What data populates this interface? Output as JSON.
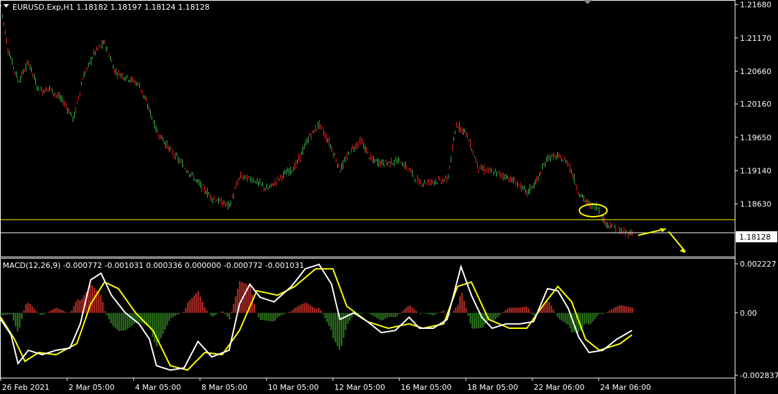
{
  "chart_data": [
    {
      "type": "candlestick",
      "title": "EURUSD.Exp,H1  1.18182 1.18197 1.18124 1.18128",
      "symbol": "EURUSD.Exp",
      "timeframe": "H1",
      "ohlc": {
        "open": 1.18182,
        "high": 1.18197,
        "low": 1.18124,
        "close": 1.18128
      },
      "current_price_label": "1.18128",
      "ylim": [
        1.1782,
        1.2174
      ],
      "yticks": [
        "1.21680",
        "1.21170",
        "1.20660",
        "1.20160",
        "1.19650",
        "1.19140",
        "1.18630"
      ],
      "x_ticks": [
        "26 Feb 2021",
        "2 Mar 05:00",
        "4 Mar 05:00",
        "8 Mar 05:00",
        "10 Mar 05:00",
        "12 Mar 05:00",
        "16 Mar 05:00",
        "18 Mar 05:00",
        "22 Mar 06:00",
        "24 Mar 06:00"
      ],
      "price_path": [
        [
          0,
          1.2166
        ],
        [
          10,
          1.21
        ],
        [
          25,
          1.205
        ],
        [
          40,
          1.208
        ],
        [
          55,
          1.2035
        ],
        [
          70,
          1.204
        ],
        [
          90,
          1.202
        ],
        [
          105,
          1.1993
        ],
        [
          118,
          1.2055
        ],
        [
          135,
          1.2095
        ],
        [
          150,
          1.211
        ],
        [
          165,
          1.2065
        ],
        [
          185,
          1.2055
        ],
        [
          200,
          1.2045
        ],
        [
          215,
          1.2005
        ],
        [
          225,
          1.1975
        ],
        [
          245,
          1.1945
        ],
        [
          265,
          1.192
        ],
        [
          285,
          1.1895
        ],
        [
          305,
          1.1872
        ],
        [
          330,
          1.186
        ],
        [
          345,
          1.1905
        ],
        [
          365,
          1.19
        ],
        [
          385,
          1.1885
        ],
        [
          405,
          1.1905
        ],
        [
          425,
          1.192
        ],
        [
          445,
          1.1965
        ],
        [
          460,
          1.1985
        ],
        [
          475,
          1.1955
        ],
        [
          490,
          1.1915
        ],
        [
          505,
          1.1945
        ],
        [
          520,
          1.196
        ],
        [
          535,
          1.193
        ],
        [
          555,
          1.1925
        ],
        [
          575,
          1.193
        ],
        [
          590,
          1.1915
        ],
        [
          605,
          1.1895
        ],
        [
          625,
          1.1898
        ],
        [
          645,
          1.19
        ],
        [
          658,
          1.1985
        ],
        [
          672,
          1.1972
        ],
        [
          690,
          1.1918
        ],
        [
          710,
          1.1912
        ],
        [
          730,
          1.1905
        ],
        [
          745,
          1.1895
        ],
        [
          760,
          1.188
        ],
        [
          775,
          1.19
        ],
        [
          790,
          1.1935
        ],
        [
          805,
          1.1935
        ],
        [
          820,
          1.1925
        ],
        [
          835,
          1.188
        ],
        [
          848,
          1.1863
        ],
        [
          862,
          1.1858
        ],
        [
          872,
          1.1835
        ],
        [
          885,
          1.1828
        ],
        [
          898,
          1.182
        ],
        [
          912,
          1.1818
        ]
      ],
      "levels": [
        1.1839,
        1.1819
      ],
      "annotations": [
        "ellipse-around-consolidation",
        "arrow-up",
        "arrow-down"
      ],
      "colors": {
        "bull": "#39b54a",
        "bear": "#e02020",
        "level": "#ffff00",
        "axis": "#ffffff"
      }
    },
    {
      "type": "macd",
      "title": "MACD(12,26,9) -0.000772 -0.001031 0.000336 0.000000 -0.000772 -0.001031",
      "ylim": [
        -0.002837,
        0.002227
      ],
      "yticks": [
        "0.002227",
        "0.00",
        "-0.002837"
      ],
      "series": [
        {
          "name": "MACD",
          "color": "#ffffff",
          "points": [
            [
              0,
              -0.0003
            ],
            [
              15,
              -0.001
            ],
            [
              25,
              -0.0023
            ],
            [
              40,
              -0.0017
            ],
            [
              60,
              -0.0019
            ],
            [
              80,
              -0.0017
            ],
            [
              100,
              -0.0016
            ],
            [
              115,
              -0.0005
            ],
            [
              130,
              0.0015
            ],
            [
              145,
              0.0018
            ],
            [
              160,
              0.0008
            ],
            [
              180,
              0.0
            ],
            [
              200,
              -0.0005
            ],
            [
              215,
              -0.0012
            ],
            [
              225,
              -0.0024
            ],
            [
              245,
              -0.0026
            ],
            [
              265,
              -0.0025
            ],
            [
              285,
              -0.0013
            ],
            [
              305,
              -0.002
            ],
            [
              330,
              -0.0017
            ],
            [
              345,
              0.0004
            ],
            [
              360,
              0.0013
            ],
            [
              375,
              0.0007
            ],
            [
              395,
              0.0005
            ],
            [
              420,
              0.0012
            ],
            [
              440,
              0.002
            ],
            [
              460,
              0.0022
            ],
            [
              478,
              0.0013
            ],
            [
              490,
              -0.0003
            ],
            [
              510,
              0.0
            ],
            [
              530,
              -0.0004
            ],
            [
              550,
              -0.0009
            ],
            [
              570,
              -0.0008
            ],
            [
              590,
              -0.0002
            ],
            [
              605,
              -0.0007
            ],
            [
              625,
              -0.0007
            ],
            [
              645,
              -0.0003
            ],
            [
              665,
              0.0021
            ],
            [
              680,
              0.0008
            ],
            [
              695,
              -0.0002
            ],
            [
              710,
              -0.0007
            ],
            [
              730,
              -0.0005
            ],
            [
              750,
              -0.0005
            ],
            [
              770,
              -0.0004
            ],
            [
              790,
              0.0011
            ],
            [
              805,
              0.001
            ],
            [
              820,
              0.0002
            ],
            [
              835,
              -0.0011
            ],
            [
              850,
              -0.0018
            ],
            [
              870,
              -0.0017
            ],
            [
              890,
              -0.0012
            ],
            [
              912,
              -0.0008
            ]
          ]
        },
        {
          "name": "Signal",
          "color": "#ffff00",
          "points": [
            [
              0,
              -0.0002
            ],
            [
              20,
              -0.0012
            ],
            [
              35,
              -0.0022
            ],
            [
              55,
              -0.0018
            ],
            [
              80,
              -0.0019
            ],
            [
              110,
              -0.0014
            ],
            [
              130,
              0.0004
            ],
            [
              150,
              0.0014
            ],
            [
              170,
              0.0011
            ],
            [
              195,
              0.0
            ],
            [
              220,
              -0.0008
            ],
            [
              245,
              -0.0024
            ],
            [
              270,
              -0.0026
            ],
            [
              295,
              -0.0018
            ],
            [
              320,
              -0.0019
            ],
            [
              345,
              -0.0008
            ],
            [
              370,
              0.001
            ],
            [
              400,
              0.0008
            ],
            [
              425,
              0.0012
            ],
            [
              455,
              0.002
            ],
            [
              480,
              0.002
            ],
            [
              500,
              0.0003
            ],
            [
              530,
              -0.0004
            ],
            [
              560,
              -0.0007
            ],
            [
              590,
              -0.0005
            ],
            [
              610,
              -0.0007
            ],
            [
              640,
              -0.0005
            ],
            [
              660,
              0.0012
            ],
            [
              680,
              0.0014
            ],
            [
              705,
              -0.0003
            ],
            [
              735,
              -0.0007
            ],
            [
              760,
              -0.0007
            ],
            [
              785,
              0.0004
            ],
            [
              805,
              0.0012
            ],
            [
              825,
              0.0005
            ],
            [
              845,
              -0.0012
            ],
            [
              865,
              -0.0017
            ],
            [
              895,
              -0.0014
            ],
            [
              912,
              -0.001
            ]
          ]
        }
      ],
      "histogram_color_positive": "#c0302a",
      "histogram_color_negative": "#2e7d1e"
    }
  ]
}
